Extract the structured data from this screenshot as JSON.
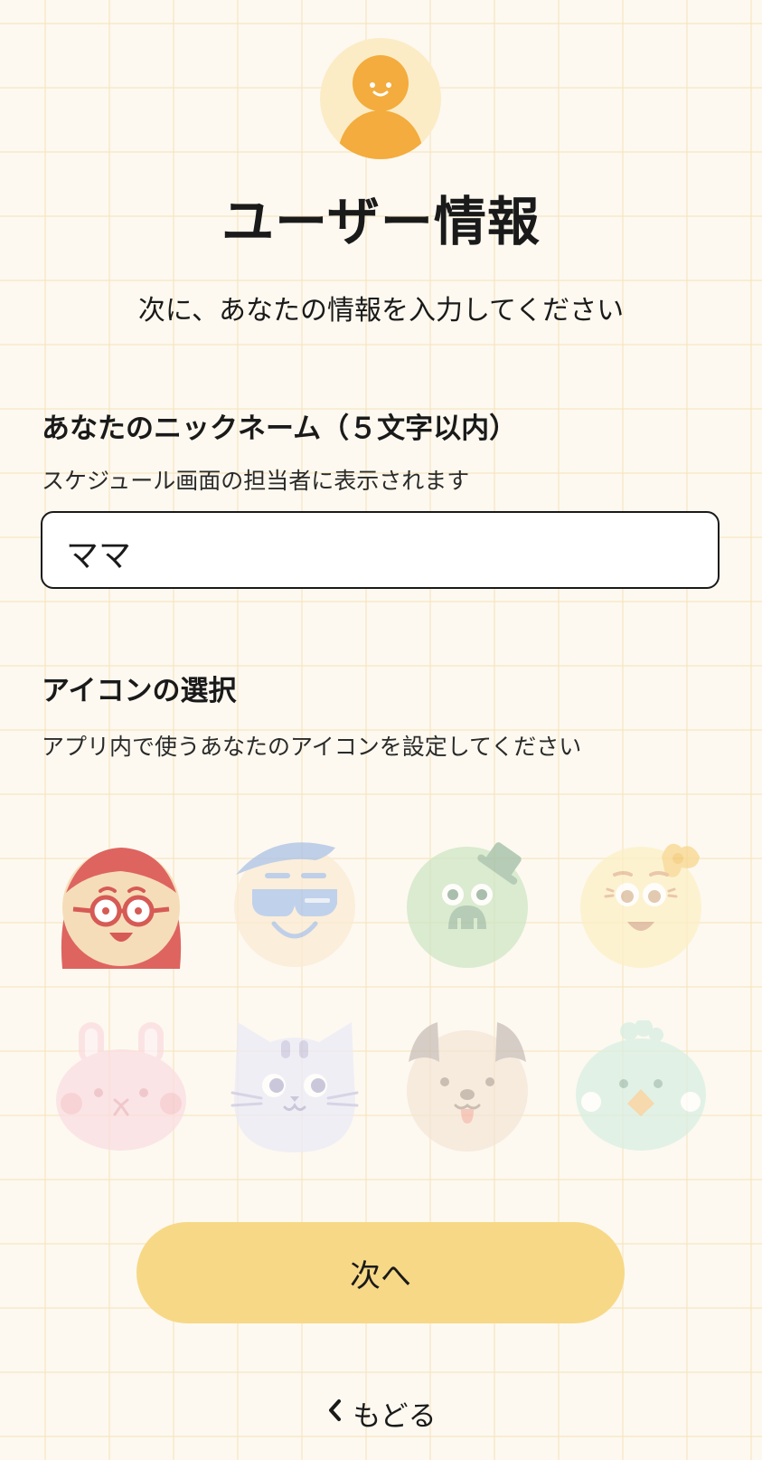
{
  "header": {
    "avatar_icon": "user-avatar-icon",
    "title": "ユーザー情報",
    "subtitle": "次に、あなたの情報を入力してください"
  },
  "nickname": {
    "label": "あなたのニックネーム（５文字以内）",
    "hint": "スケジュール画面の担当者に表示されます",
    "value": "ママ"
  },
  "icon_select": {
    "label": "アイコンの選択",
    "hint": "アプリ内で使うあなたのアイコンを設定してください",
    "selected": "glasses-girl-icon",
    "options": [
      "glasses-girl-icon",
      "sunglasses-man-icon",
      "hat-frog-icon",
      "bow-girl-icon",
      "rabbit-icon",
      "cat-icon",
      "dog-icon",
      "bird-icon"
    ]
  },
  "colors": {
    "background": "#fdf9f0",
    "accent": "#f3ac3d",
    "button": "#f7d886"
  },
  "actions": {
    "next_label": "次へ",
    "back_label": "もどる",
    "back_icon": "chevron-left-icon"
  }
}
